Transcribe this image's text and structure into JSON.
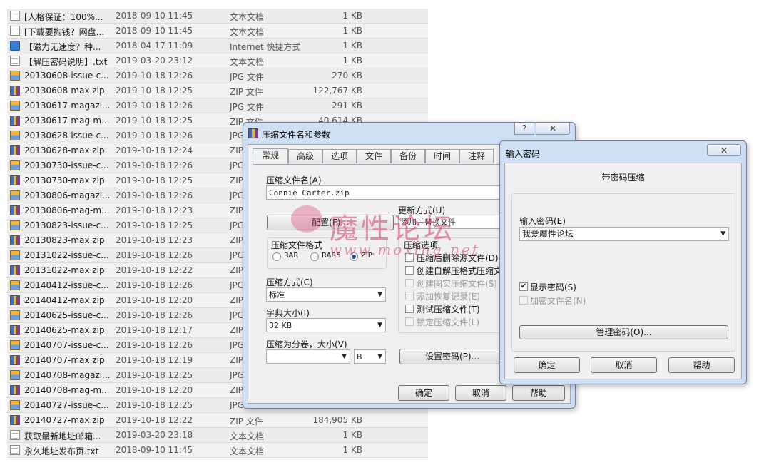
{
  "file_list": [
    {
      "name": "[人格保证：100%...",
      "date": "2018-09-10 11:45",
      "type": "文本文档",
      "size": "1 KB",
      "icon": "text-file-icon"
    },
    {
      "name": "[下载要掏钱？网盘...",
      "date": "2018-09-10 11:45",
      "type": "文本文档",
      "size": "1 KB",
      "icon": "text-file-icon"
    },
    {
      "name": "【磁力无速度？种...",
      "date": "2018-04-17 11:09",
      "type": "Internet 快捷方式",
      "size": "1 KB",
      "icon": "internet-shortcut-icon"
    },
    {
      "name": "【解压密码说明】.txt",
      "date": "2019-03-20 23:12",
      "type": "文本文档",
      "size": "1 KB",
      "icon": "text-file-icon"
    },
    {
      "name": "20130608-issue-c...",
      "date": "2019-10-18 12:26",
      "type": "JPG 文件",
      "size": "270 KB",
      "icon": "jpg-file-icon"
    },
    {
      "name": "20130608-max.zip",
      "date": "2019-10-18 12:25",
      "type": "ZIP 文件",
      "size": "122,767 KB",
      "icon": "zip-file-icon"
    },
    {
      "name": "20130617-magazi...",
      "date": "2019-10-18 12:26",
      "type": "JPG 文件",
      "size": "291 KB",
      "icon": "jpg-file-icon"
    },
    {
      "name": "20130617-mag-m...",
      "date": "2019-10-18 12:25",
      "type": "ZIP 文件",
      "size": "40,614 KB",
      "icon": "zip-file-icon"
    },
    {
      "name": "20130628-issue-c...",
      "date": "2019-10-18 12:26",
      "type": "JPG",
      "size": "",
      "icon": "jpg-file-icon"
    },
    {
      "name": "20130628-max.zip",
      "date": "2019-10-18 12:24",
      "type": "ZIP",
      "size": "",
      "icon": "zip-file-icon"
    },
    {
      "name": "20130730-issue-c...",
      "date": "2019-10-18 12:26",
      "type": "JPG",
      "size": "",
      "icon": "jpg-file-icon"
    },
    {
      "name": "20130730-max.zip",
      "date": "2019-10-18 12:25",
      "type": "ZIP",
      "size": "",
      "icon": "zip-file-icon"
    },
    {
      "name": "20130806-magazi...",
      "date": "2019-10-18 12:26",
      "type": "JPG",
      "size": "",
      "icon": "jpg-file-icon"
    },
    {
      "name": "20130806-mag-m...",
      "date": "2019-10-18 12:23",
      "type": "ZIP",
      "size": "",
      "icon": "zip-file-icon"
    },
    {
      "name": "20130823-issue-c...",
      "date": "2019-10-18 12:25",
      "type": "JPG",
      "size": "",
      "icon": "jpg-file-icon"
    },
    {
      "name": "20130823-max.zip",
      "date": "2019-10-18 12:23",
      "type": "ZIP",
      "size": "",
      "icon": "zip-file-icon"
    },
    {
      "name": "20131022-issue-c...",
      "date": "2019-10-18 12:26",
      "type": "JPG",
      "size": "",
      "icon": "jpg-file-icon"
    },
    {
      "name": "20131022-max.zip",
      "date": "2019-10-18 12:22",
      "type": "ZIP",
      "size": "",
      "icon": "zip-file-icon"
    },
    {
      "name": "20140412-issue-c...",
      "date": "2019-10-18 12:26",
      "type": "JPG",
      "size": "",
      "icon": "jpg-file-icon"
    },
    {
      "name": "20140412-max.zip",
      "date": "2019-10-18 12:20",
      "type": "ZIP",
      "size": "",
      "icon": "zip-file-icon"
    },
    {
      "name": "20140625-issue-c...",
      "date": "2019-10-18 12:26",
      "type": "JPG",
      "size": "",
      "icon": "jpg-file-icon"
    },
    {
      "name": "20140625-max.zip",
      "date": "2019-10-18 12:17",
      "type": "ZIP",
      "size": "",
      "icon": "zip-file-icon"
    },
    {
      "name": "20140707-issue-c...",
      "date": "2019-10-18 12:26",
      "type": "JPG",
      "size": "",
      "icon": "jpg-file-icon"
    },
    {
      "name": "20140707-max.zip",
      "date": "2019-10-18 12:19",
      "type": "ZIP",
      "size": "",
      "icon": "zip-file-icon"
    },
    {
      "name": "20140708-magazi...",
      "date": "2019-10-18 12:25",
      "type": "JPG",
      "size": "",
      "icon": "jpg-file-icon"
    },
    {
      "name": "20140708-mag-m...",
      "date": "2019-10-18 12:20",
      "type": "ZIP",
      "size": "",
      "icon": "zip-file-icon"
    },
    {
      "name": "20140727-issue-c...",
      "date": "2019-10-18 12:25",
      "type": "JPG",
      "size": "",
      "icon": "jpg-file-icon"
    },
    {
      "name": "20140727-max.zip",
      "date": "2019-10-18 12:22",
      "type": "ZIP 文件",
      "size": "184,905 KB",
      "icon": "zip-file-icon"
    },
    {
      "name": "获取最新地址邮箱...",
      "date": "2019-03-20 23:18",
      "type": "文本文档",
      "size": "1 KB",
      "icon": "text-file-icon"
    },
    {
      "name": "永久地址发布页.txt",
      "date": "2018-09-10 11:45",
      "type": "文本文档",
      "size": "1 KB",
      "icon": "text-file-icon"
    }
  ],
  "archive_dialog": {
    "title": "压缩文件名和参数",
    "help_btn": "?",
    "close_btn": "✕",
    "app_icon": "winrar-icon",
    "tabs": [
      "常规",
      "高级",
      "选项",
      "文件",
      "备份",
      "时间",
      "注释"
    ],
    "archive_name_label": "压缩文件名(A)",
    "archive_name_value": "Connie Carter.zip",
    "profiles_btn": "配置(F)...",
    "update_mode_label": "更新方式(U)",
    "update_mode_value": "添加并替换文件",
    "format_label": "压缩文件格式",
    "format_options": [
      "RAR",
      "RAR5",
      "ZIP"
    ],
    "format_selected": "ZIP",
    "method_label": "压缩方式(C)",
    "method_value": "标准",
    "dict_label": "字典大小(I)",
    "dict_value": "32 KB",
    "split_label": "压缩为分卷，大小(V)",
    "split_value": "",
    "split_unit": "B",
    "options_label": "压缩选项",
    "options": [
      {
        "label": "压缩后删除源文件(D)",
        "checked": false,
        "disabled": false
      },
      {
        "label": "创建自解压格式压缩文",
        "checked": false,
        "disabled": false
      },
      {
        "label": "创建固实压缩文件(S)",
        "checked": false,
        "disabled": true
      },
      {
        "label": "添加恢复记录(E)",
        "checked": false,
        "disabled": true
      },
      {
        "label": "测试压缩文件(T)",
        "checked": false,
        "disabled": false
      },
      {
        "label": "锁定压缩文件(L)",
        "checked": false,
        "disabled": true
      }
    ],
    "set_password_btn": "设置密码(P)...",
    "ok_btn": "确定",
    "cancel_btn": "取消",
    "help_bottom_btn": "帮助"
  },
  "password_dialog": {
    "title": "输入密码",
    "close_btn": "✕",
    "heading": "带密码压缩",
    "password_label": "输入密码(E)",
    "password_value": "我爱魔性论坛",
    "show_password_label": "显示密码(S)",
    "show_password_checked": true,
    "encrypt_names_label": "加密文件名(N)",
    "encrypt_names_checked": false,
    "organize_btn": "管理密码(O)...",
    "ok_btn": "确定",
    "cancel_btn": "取消",
    "help_btn": "帮助"
  },
  "watermark": {
    "text": "魔性论坛",
    "url": "www.moxing.net",
    "color": "#d9386f"
  }
}
